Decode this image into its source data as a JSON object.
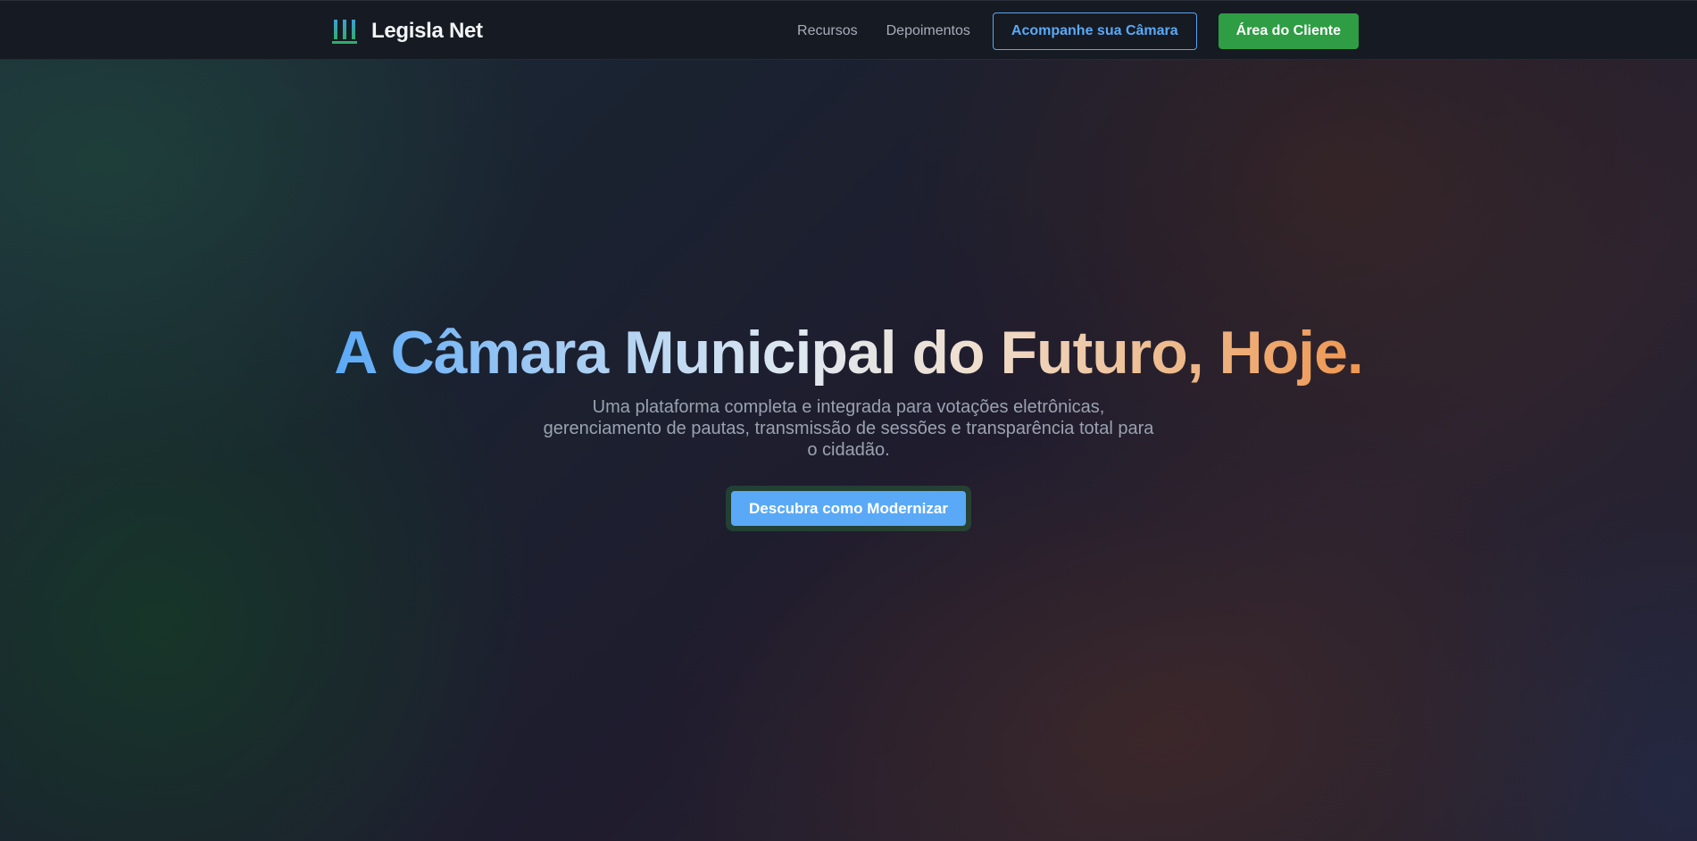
{
  "navbar": {
    "brand": {
      "name": "Legisla Net",
      "icon": "columns-logo-icon"
    },
    "links": [
      {
        "label": "Recursos"
      },
      {
        "label": "Depoimentos"
      }
    ],
    "outline_button": "Acompanhe sua Câmara",
    "primary_button": "Área do Cliente"
  },
  "hero": {
    "title": "A Câmara Municipal do Futuro, Hoje.",
    "subtitle": "Uma plataforma completa e integrada para votações eletrônicas, gerenciamento de pautas, transmissão de sessões e transparência total para o cidadão.",
    "cta_button": "Descubra como Modernizar"
  },
  "colors": {
    "accent_blue": "#5aa9f7",
    "accent_green": "#2e9d44",
    "accent_orange": "#ee9650",
    "navbar_bg": "#161a22"
  }
}
